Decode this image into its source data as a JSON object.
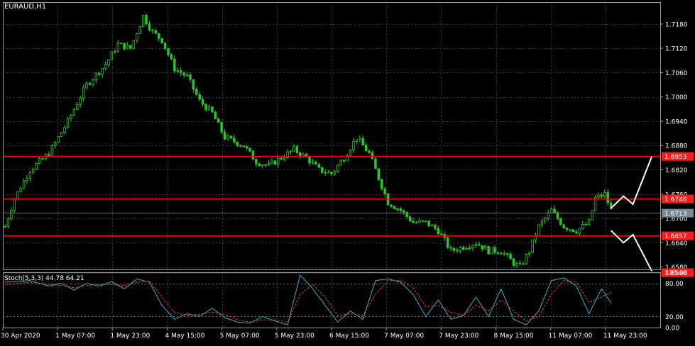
{
  "symbol_label": "EURAUD,H1",
  "stoch_label": "Stoch(5,3,3) 44.78 64.21",
  "colors": {
    "background": "#000000",
    "grid": "#3a3a3a",
    "frame": "#9a9a9a",
    "candle": "#22cc22",
    "level_line": "#ff0000",
    "level_label_bg": "#ff1a1a",
    "current_price_bg": "#7a8a95",
    "zigzag": "#ffffff",
    "stoch_main": "#23b5c8",
    "stoch_signal": "#ff3030"
  },
  "chart_data": [
    {
      "type": "candlestick",
      "title": "EURAUD,H1",
      "ylim": [
        1.6574,
        1.7234
      ],
      "y_ticks": [
        "1.7180",
        "1.7120",
        "1.7060",
        "1.7000",
        "1.6940",
        "1.6880",
        "1.6820",
        "1.6760",
        "1.6700",
        "1.6640",
        "1.6580"
      ],
      "x_ticks": [
        "30 Apr 2020",
        "1 May 07:00",
        "1 May 23:00",
        "4 May 15:00",
        "5 May 07:00",
        "5 May 23:00",
        "6 May 15:00",
        "7 May 07:00",
        "7 May 23:00",
        "8 May 15:00",
        "11 May 07:00",
        "11 May 23:00"
      ],
      "close_path": [
        [
          0,
          1.668
        ],
        [
          3,
          1.675
        ],
        [
          8,
          1.682
        ],
        [
          14,
          1.686
        ],
        [
          20,
          1.694
        ],
        [
          26,
          1.703
        ],
        [
          32,
          1.708
        ],
        [
          36,
          1.713
        ],
        [
          40,
          1.712
        ],
        [
          44,
          1.72
        ],
        [
          47,
          1.716
        ],
        [
          50,
          1.714
        ],
        [
          54,
          1.707
        ],
        [
          58,
          1.705
        ],
        [
          62,
          1.699
        ],
        [
          66,
          1.696
        ],
        [
          70,
          1.69
        ],
        [
          76,
          1.688
        ],
        [
          80,
          1.684
        ],
        [
          84,
          1.683
        ],
        [
          88,
          1.685
        ],
        [
          92,
          1.687
        ],
        [
          96,
          1.685
        ],
        [
          100,
          1.682
        ],
        [
          104,
          1.681
        ],
        [
          108,
          1.685
        ],
        [
          112,
          1.69
        ],
        [
          116,
          1.686
        ],
        [
          119,
          1.68
        ],
        [
          122,
          1.674
        ],
        [
          126,
          1.672
        ],
        [
          130,
          1.669
        ],
        [
          134,
          1.669
        ],
        [
          138,
          1.667
        ],
        [
          142,
          1.662
        ],
        [
          146,
          1.663
        ],
        [
          150,
          1.664
        ],
        [
          154,
          1.662
        ],
        [
          158,
          1.662
        ],
        [
          162,
          1.659
        ],
        [
          164,
          1.658
        ],
        [
          167,
          1.662
        ],
        [
          170,
          1.668
        ],
        [
          174,
          1.672
        ],
        [
          178,
          1.668
        ],
        [
          182,
          1.667
        ],
        [
          186,
          1.669
        ],
        [
          188,
          1.675
        ],
        [
          191,
          1.676
        ],
        [
          193,
          1.672
        ]
      ],
      "candles_count": 194,
      "levels": [
        {
          "price": 1.6853,
          "label": "1.6853"
        },
        {
          "price": 1.6748,
          "label": "1.6748"
        },
        {
          "price": 1.6657,
          "label": "1.6657"
        },
        {
          "price": 1.6566,
          "label": "1.6566"
        }
      ],
      "current_price": {
        "price": 1.6713,
        "label": "1.6713"
      },
      "projection_up": [
        [
          193,
          1.6725
        ],
        [
          197,
          1.6755
        ],
        [
          200,
          1.6735
        ],
        [
          206,
          1.6853
        ]
      ],
      "projection_down": [
        [
          193,
          1.667
        ],
        [
          197,
          1.664
        ],
        [
          200,
          1.666
        ],
        [
          206,
          1.657
        ]
      ]
    },
    {
      "type": "line",
      "title": "Stoch(5,3,3) 44.78 64.21",
      "ylim": [
        0,
        100
      ],
      "y_ticks": [
        "100.00",
        "80.00",
        "20.00",
        "0.00"
      ],
      "levels": [
        80,
        20
      ],
      "series": [
        {
          "name": "main",
          "color": "#23b5c8",
          "points": [
            [
              0,
              82
            ],
            [
              8,
              85
            ],
            [
              14,
              75
            ],
            [
              18,
              80
            ],
            [
              22,
              68
            ],
            [
              26,
              80
            ],
            [
              30,
              75
            ],
            [
              34,
              83
            ],
            [
              38,
              70
            ],
            [
              42,
              88
            ],
            [
              46,
              82
            ],
            [
              50,
              40
            ],
            [
              54,
              15
            ],
            [
              58,
              25
            ],
            [
              62,
              20
            ],
            [
              66,
              35
            ],
            [
              70,
              18
            ],
            [
              74,
              10
            ],
            [
              78,
              8
            ],
            [
              82,
              20
            ],
            [
              86,
              12
            ],
            [
              90,
              5
            ],
            [
              94,
              95
            ],
            [
              98,
              70
            ],
            [
              102,
              40
            ],
            [
              106,
              10
            ],
            [
              110,
              30
            ],
            [
              114,
              15
            ],
            [
              118,
              85
            ],
            [
              122,
              88
            ],
            [
              126,
              82
            ],
            [
              130,
              60
            ],
            [
              134,
              20
            ],
            [
              138,
              50
            ],
            [
              142,
              15
            ],
            [
              146,
              22
            ],
            [
              150,
              55
            ],
            [
              154,
              20
            ],
            [
              158,
              70
            ],
            [
              162,
              15
            ],
            [
              166,
              5
            ],
            [
              170,
              30
            ],
            [
              174,
              85
            ],
            [
              178,
              90
            ],
            [
              182,
              75
            ],
            [
              186,
              25
            ],
            [
              190,
              70
            ],
            [
              193,
              44.78
            ]
          ]
        },
        {
          "name": "signal",
          "color": "#ff3030",
          "points": [
            [
              0,
              78
            ],
            [
              8,
              82
            ],
            [
              14,
              78
            ],
            [
              18,
              76
            ],
            [
              22,
              72
            ],
            [
              26,
              76
            ],
            [
              30,
              78
            ],
            [
              34,
              78
            ],
            [
              38,
              76
            ],
            [
              42,
              82
            ],
            [
              46,
              84
            ],
            [
              50,
              55
            ],
            [
              54,
              28
            ],
            [
              58,
              22
            ],
            [
              62,
              24
            ],
            [
              66,
              28
            ],
            [
              70,
              24
            ],
            [
              74,
              14
            ],
            [
              78,
              10
            ],
            [
              82,
              14
            ],
            [
              86,
              14
            ],
            [
              90,
              10
            ],
            [
              94,
              60
            ],
            [
              98,
              78
            ],
            [
              102,
              55
            ],
            [
              106,
              22
            ],
            [
              110,
              25
            ],
            [
              114,
              22
            ],
            [
              118,
              60
            ],
            [
              122,
              85
            ],
            [
              126,
              85
            ],
            [
              130,
              72
            ],
            [
              134,
              38
            ],
            [
              138,
              40
            ],
            [
              142,
              28
            ],
            [
              146,
              22
            ],
            [
              150,
              40
            ],
            [
              154,
              30
            ],
            [
              158,
              50
            ],
            [
              162,
              30
            ],
            [
              166,
              12
            ],
            [
              170,
              20
            ],
            [
              174,
              60
            ],
            [
              178,
              85
            ],
            [
              182,
              82
            ],
            [
              186,
              45
            ],
            [
              190,
              55
            ],
            [
              193,
              64.21
            ]
          ]
        }
      ]
    }
  ]
}
